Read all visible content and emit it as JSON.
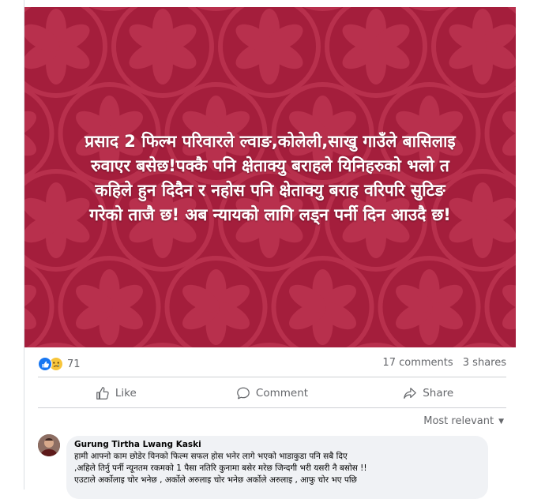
{
  "post": {
    "image_text_lines": [
      "प्रसाद 2 फिल्म परिवारले ल्वाङ,कोलेली,साखु गाउँले बासिलाइ",
      "रुवाएर बसेछ!पक्कै पनि क्षेताक्यु बराहले यिनिहरुको भलो त",
      "कहिले हुन दिदैन र नहोस पनि क्षेताक्यु बराह वरिपरि सुटिङ",
      "गरेको ताजै छ! अब न्यायको लागि लड्न पर्नी दिन आउदै छ!"
    ],
    "image_bg_color": "#a41e3c",
    "pattern_color": "#b8304d"
  },
  "stats": {
    "reaction_count": "71",
    "reaction_icons": [
      "like-icon",
      "sad-icon"
    ],
    "comments": "17 comments",
    "shares": "3 shares"
  },
  "actions": {
    "like_label": "Like",
    "comment_label": "Comment",
    "share_label": "Share"
  },
  "comments_section": {
    "sort_label": "Most relevant"
  },
  "comment": {
    "author": "Gurung Tirtha Lwang Kaski",
    "lines": [
      "हामी आफ्नो काम छोडेर यिनको फिल्म सफल होस भनेर लागे भएको भाडाकुडा पनि सबै दिए",
      ",अहिले तिर्नु पर्नी न्यूनतम रकमको 1 पैसा नतिरि कुनामा बसेर मरेछ जिन्दगी भरी यसरी नै बसोस !!",
      "एउटाले अर्कोलाइ चोर भनेछ , अर्कोले अरुलाइ चोर भनेछ अर्कोले अरुलाइ , आफु चोर भए पछि"
    ]
  },
  "colors": {
    "accent_blue": "#1877f2",
    "secondary_text": "#65676b",
    "comment_bg": "#f0f2f5"
  }
}
